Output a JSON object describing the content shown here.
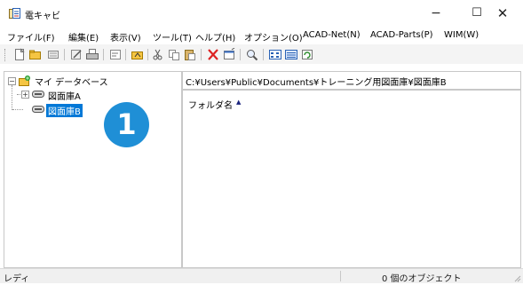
{
  "window": {
    "title": "電キャビ",
    "icon": "app-icon",
    "minimize_label": "−",
    "maximize_label": "☐",
    "close_label": "✕"
  },
  "menu": [
    "ファイル(F)",
    "編集(E)",
    "表示(V)",
    "ツール(T)",
    "ヘルプ(H)",
    "オプション(O)",
    "ACAD-Net(N)",
    "ACAD-Parts(P)",
    "WIM(W)"
  ],
  "toolbar": {
    "icons": [
      "new-icon",
      "open-folder-icon",
      "list-icon",
      "edit-icon",
      "print-icon",
      "properties-icon",
      "folder-up-icon",
      "cut-icon",
      "copy-icon",
      "paste-icon",
      "delete-icon",
      "settings-icon",
      "search-icon",
      "view-small-icon",
      "view-details-icon",
      "refresh-icon"
    ]
  },
  "tree": {
    "root": "マイ データベース",
    "children": [
      "図面庫A",
      "図面庫B"
    ],
    "selected": "図面庫B"
  },
  "badge": {
    "number": "1",
    "color": "#1f8fd6"
  },
  "path": "C:¥Users¥Public¥Documents¥トレーニング用図面庫¥図面庫B",
  "list": {
    "column_header": "フォルダ名",
    "sort_indicator": "▲"
  },
  "status": {
    "left": "レディ",
    "right": "0 個のオブジェクト"
  },
  "colors": {
    "selection": "#0078d7",
    "badge": "#1f8fd6"
  }
}
